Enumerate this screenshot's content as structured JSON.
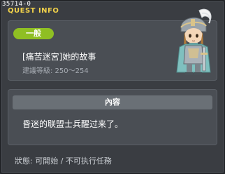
{
  "window": {
    "quest_id": "35714-0",
    "title": "QUEST INFO"
  },
  "quest": {
    "category": "一般",
    "name": "[痛苦迷宮]她的故事",
    "level_requirement": "建議等級: 250～254"
  },
  "npc": {
    "icon": "armored-knight-npc-sprite"
  },
  "content": {
    "header": "內容",
    "text": "昏迷的联盟士兵醒过来了。"
  },
  "status": {
    "text": "狀態: 可開始 / 不可执行任務"
  },
  "colors": {
    "title": "#f2d24a",
    "badge": "#8fbf23",
    "panel": "#4a4e54",
    "background": "#3a3d42"
  }
}
